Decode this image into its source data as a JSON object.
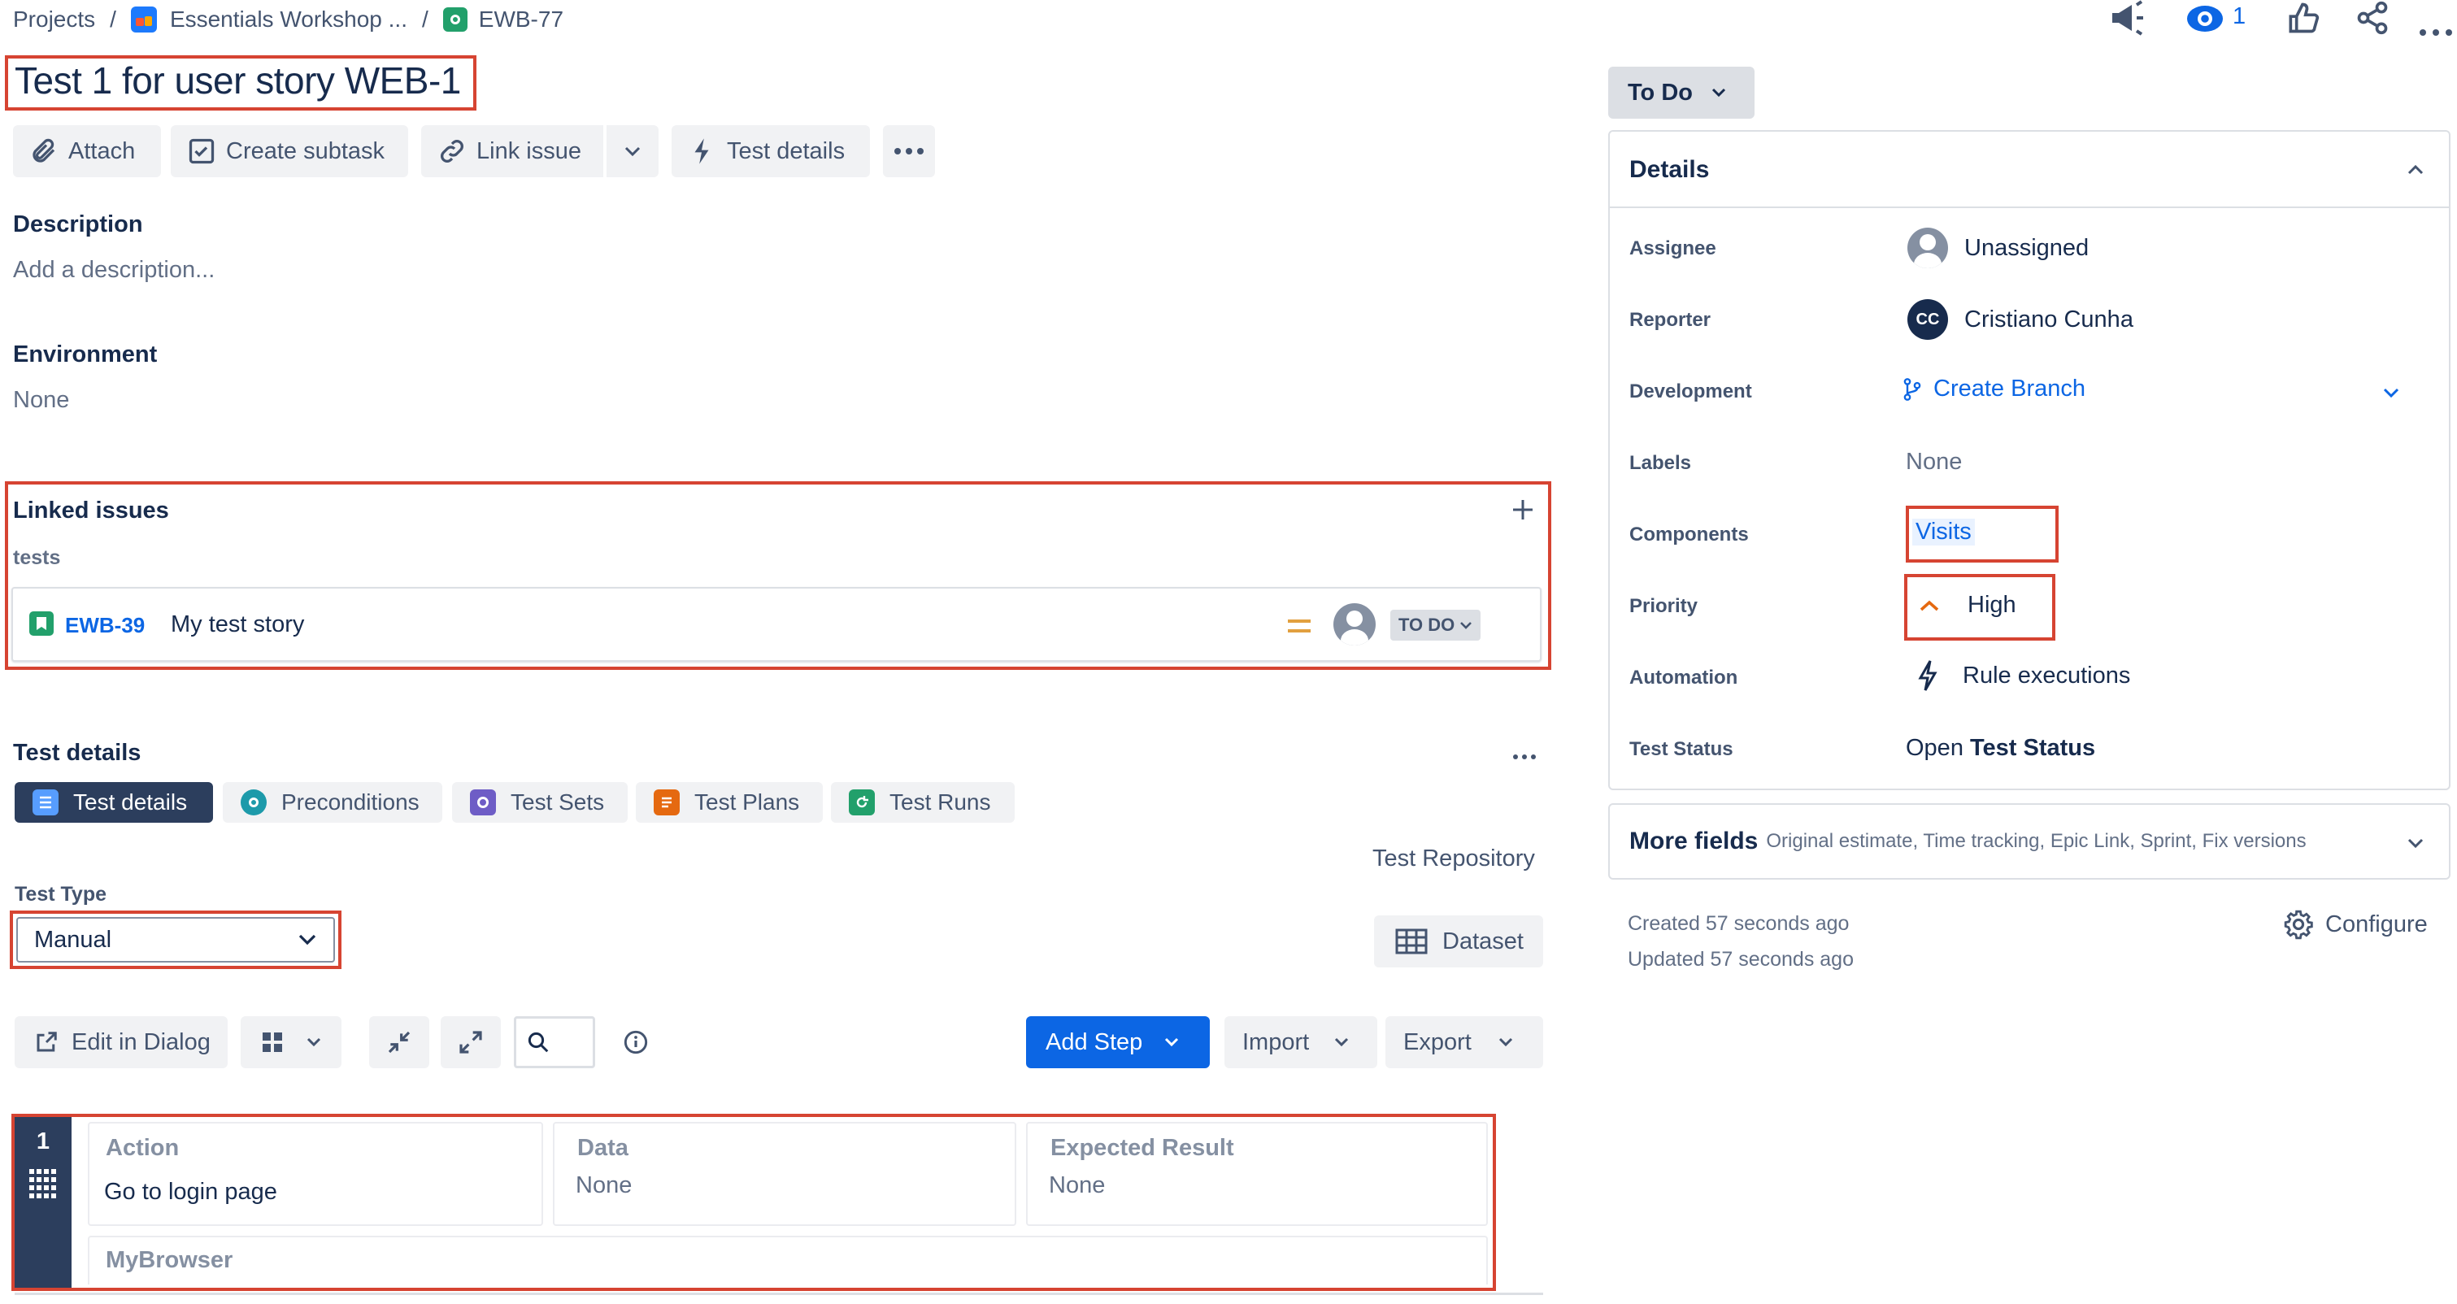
{
  "breadcrumb": {
    "projects": "Projects",
    "separator": "/",
    "project": "Essentials Workshop ...",
    "issue_key": "EWB-77"
  },
  "topbar": {
    "watch_count": "1"
  },
  "issue": {
    "title": "Test 1 for user story WEB-1"
  },
  "toolbar": {
    "attach": "Attach",
    "create_subtask": "Create subtask",
    "link_issue": "Link issue",
    "test_details": "Test details"
  },
  "description": {
    "label": "Description",
    "placeholder": "Add a description..."
  },
  "environment": {
    "label": "Environment",
    "value": "None"
  },
  "linked_issues": {
    "label": "Linked issues",
    "relation": "tests",
    "item": {
      "key": "EWB-39",
      "summary": "My test story",
      "status": "TO DO"
    }
  },
  "test_details": {
    "label": "Test details",
    "tabs": [
      "Test details",
      "Preconditions",
      "Test Sets",
      "Test Plans",
      "Test Runs"
    ],
    "repository": "Test Repository",
    "test_type_label": "Test Type",
    "test_type_value": "Manual",
    "dataset": "Dataset",
    "edit_in_dialog": "Edit in Dialog",
    "add_step": "Add Step",
    "import": "Import",
    "export": "Export",
    "step": {
      "number": "1",
      "action_label": "Action",
      "action_value": "Go to login page",
      "data_label": "Data",
      "data_value": "None",
      "expected_label": "Expected Result",
      "expected_value": "None",
      "custom_label": "MyBrowser"
    }
  },
  "status_button": "To Do",
  "details": {
    "header": "Details",
    "assignee_label": "Assignee",
    "assignee_value": "Unassigned",
    "reporter_label": "Reporter",
    "reporter_initials": "CC",
    "reporter_value": "Cristiano Cunha",
    "development_label": "Development",
    "development_value": "Create Branch",
    "labels_label": "Labels",
    "labels_value": "None",
    "components_label": "Components",
    "components_value": "Visits",
    "priority_label": "Priority",
    "priority_value": "High",
    "automation_label": "Automation",
    "automation_value": "Rule executions",
    "test_status_label": "Test Status",
    "test_status_open": "Open",
    "test_status_bold": "Test Status"
  },
  "more_fields": {
    "label": "More fields",
    "hint": "Original estimate, Time tracking, Epic Link, Sprint, Fix versions"
  },
  "meta": {
    "created": "Created 57 seconds ago",
    "updated": "Updated 57 seconds ago",
    "configure": "Configure"
  },
  "colors": {
    "accent": "#0c66e4",
    "highlight": "#d64432",
    "priority": "#e56910",
    "sidebar_dark": "#2c3e5d"
  }
}
